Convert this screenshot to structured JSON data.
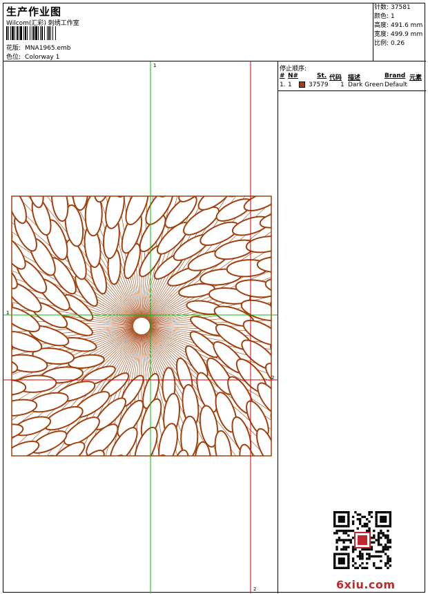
{
  "header": {
    "title": "生产作业图",
    "subtitle": "Wilcom(汇彩) 刺绣工作室",
    "design_label": "花版:",
    "design_value": "MNA1965.emb",
    "colorway_label": "色位:",
    "colorway_value": "Colorway 1"
  },
  "stats": [
    {
      "k": "针数:",
      "v": "37581"
    },
    {
      "k": "颜色:",
      "v": "1"
    },
    {
      "k": "高度:",
      "v": "491.6 mm"
    },
    {
      "k": "宽度:",
      "v": "499.9 mm"
    },
    {
      "k": "比例:",
      "v": "0.26"
    }
  ],
  "stop_sequence": {
    "title": "停止顺序:",
    "columns": {
      "hash": "#",
      "no": "N#",
      "st": "St.",
      "code": "代码",
      "desc": "描述",
      "brand": "Brand",
      "elem": "元素"
    },
    "rows": [
      {
        "idx": "1.",
        "no": "1",
        "color": "#a0400e",
        "st": "37579",
        "code": "1",
        "desc": "Dark Green",
        "brand": "Default"
      }
    ]
  },
  "axes": {
    "label_1_left": "1",
    "label_1_top": "1",
    "label_2_right": "2",
    "label_2_bottom": "2"
  },
  "colors": {
    "thread": "#a0400e",
    "green_axis": "#00c000",
    "red_axis": "#d00000"
  },
  "watermark": {
    "text": "6xiu.com"
  }
}
